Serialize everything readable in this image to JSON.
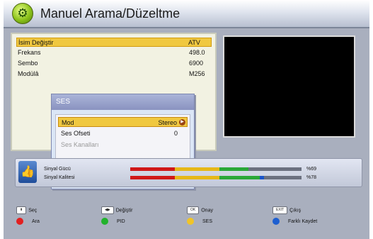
{
  "title": "Manuel Arama/Düzeltme",
  "list": [
    {
      "label": "İsim Değiştir",
      "value": "ATV"
    },
    {
      "label": "Frekans",
      "value": "498.0"
    },
    {
      "label": "Sembo",
      "value": "6900"
    },
    {
      "label": "Modülâ",
      "value": "M256"
    }
  ],
  "popup": {
    "title": "SES",
    "items": [
      {
        "label": "Mod",
        "value": "Stereo"
      },
      {
        "label": "Ses Ofseti",
        "value": "0"
      },
      {
        "label": "Ses Kanalları",
        "value": ""
      }
    ]
  },
  "signal": {
    "strength_label": "Sinyal Gücü",
    "strength_value": "%69",
    "strength_percent": 69,
    "quality_label": "Sinyal Kalitesi",
    "quality_value": "%78",
    "quality_percent": 78
  },
  "bottom": {
    "sec_key": "⬍",
    "sec": "Seç",
    "degistir_key": "◀▶",
    "degistir": "Değiştir",
    "onay_key": "OK",
    "onay": "Onay",
    "cikis_key": "EXIT",
    "cikis": "Çıkış",
    "ara": "Ara",
    "pid": "PID",
    "ses": "SES",
    "farkli": "Farklı Kaydet"
  },
  "colors": {
    "red": "#e22020",
    "green": "#22b22c",
    "yellow": "#f0c428",
    "blue": "#1e5fd0"
  }
}
